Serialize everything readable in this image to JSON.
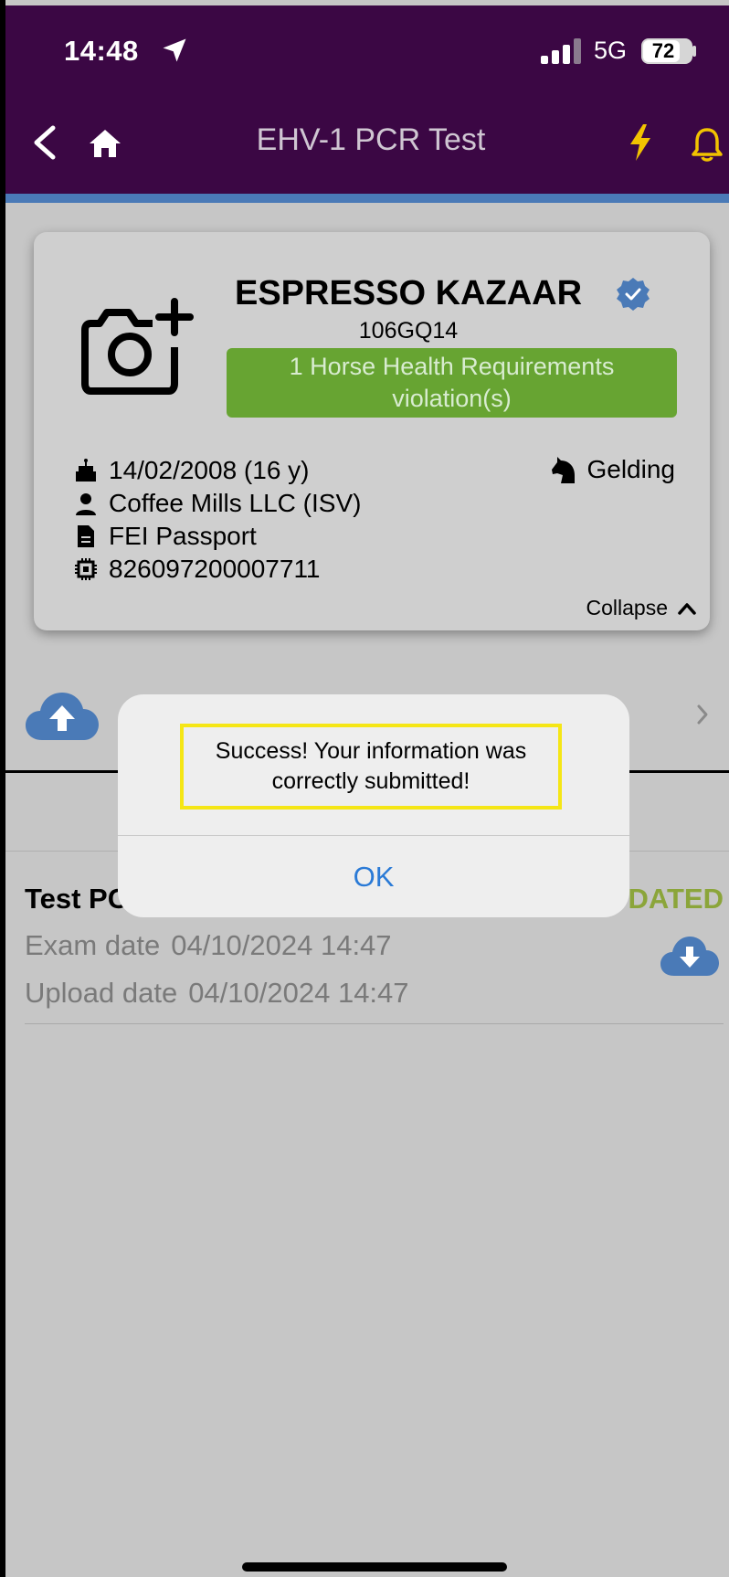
{
  "status_bar": {
    "time": "14:48",
    "network": "5G",
    "battery": "72"
  },
  "header": {
    "title": "EHV-1 PCR Test",
    "back_icon": "chevron-left-icon",
    "home_icon": "home-icon",
    "bolt_icon": "bolt-icon",
    "bell_icon": "bell-icon"
  },
  "colors": {
    "header_bg": "#3b0744",
    "accent_blue": "#4a7ab7",
    "violation_green": "#67a432",
    "status_green": "#8ba53a",
    "icon_yellow": "#f2c300",
    "link_blue": "#2a7ad6"
  },
  "horse": {
    "name": "ESPRESSO KAZAAR",
    "id": "106GQ14",
    "violation": "1 Horse Health Requirements violation(s)",
    "birth": "14/02/2008 (16 y)",
    "owner": "Coffee Mills LLC (ISV)",
    "document": "FEI Passport",
    "chip": "826097200007711",
    "gender": "Gelding",
    "collapse_label": "Collapse"
  },
  "test": {
    "title_visible": "Test PC",
    "status_visible": "DATED",
    "exam_label": "Exam date",
    "exam_date": "04/10/2024 14:47",
    "upload_label": "Upload date",
    "upload_date": "04/10/2024 14:47"
  },
  "alert": {
    "message": "Success! Your information was correctly submitted!",
    "ok_label": "OK"
  }
}
